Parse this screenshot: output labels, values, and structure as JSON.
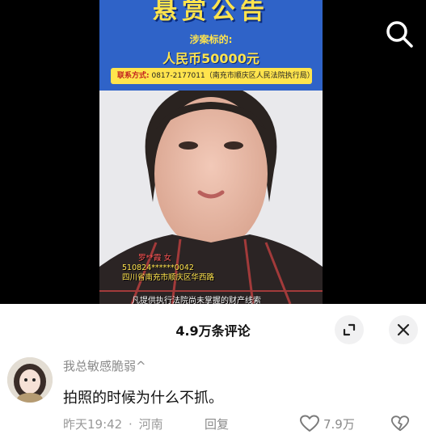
{
  "poster": {
    "title": "悬赏公告",
    "subtitle": "涉案标的:",
    "amount": "人民币50000元",
    "contact_label": "联系方式:",
    "contact_value": "0817-2177011（南充市顺庆区人民法院执行局）",
    "person_name": "罗**霞 女",
    "person_id": "510824******0042",
    "person_address": "四川省南充市顺庆区华西路",
    "caption": "凡提供执行法院尚未掌握的财产线索"
  },
  "icons": {
    "search": "search-icon",
    "expand": "expand-icon",
    "close": "close-icon",
    "like": "heart-icon",
    "dislike": "broken-heart-icon"
  },
  "comments": {
    "count_label": "4.9万条评论"
  },
  "comment": {
    "username": "我总敏感脆弱^",
    "text": "拍照的时候为什么不抓。",
    "time": "昨天19:42",
    "separator": "·",
    "location": "河南",
    "reply_label": "回复",
    "likes": "7.9万"
  }
}
